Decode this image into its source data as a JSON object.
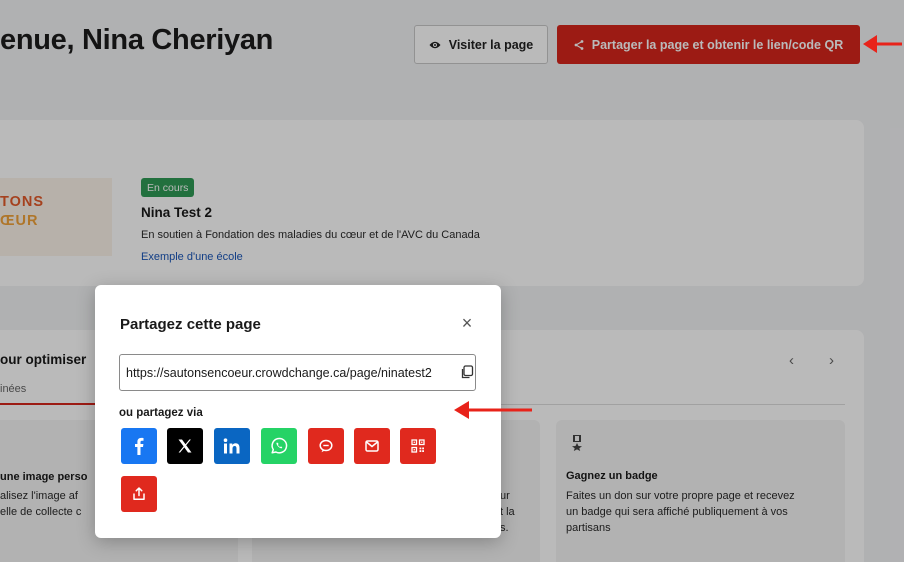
{
  "header": {
    "title": "enue, Nina Cheriyan",
    "visit_label": "Visiter la page",
    "share_label": "Partager la page et obtenir le lien/code QR"
  },
  "campaign": {
    "logo_line1": "TONS",
    "logo_line2": "ŒUR",
    "status": "En cours",
    "name": "Nina Test 2",
    "support": "En soutien à Fondation des maladies du cœur et de l'AVC du Canada",
    "school": "Exemple d'une école"
  },
  "section": {
    "title": "our optimiser",
    "tab_label": "inées",
    "prev": "‹",
    "next": "›",
    "card_left": {
      "title": "une image perso",
      "line1": "alisez l'image af",
      "line2": "elle de collecte c"
    },
    "card_middle": {
      "line1": "ur",
      "line2": "t la",
      "line3": "s."
    },
    "card_right": {
      "title": "Gagnez un badge",
      "line1": "Faites un don sur votre propre page et recevez",
      "line2": "un badge qui sera affiché publiquement à vos",
      "line3": "partisans"
    }
  },
  "modal": {
    "title": "Partagez cette page",
    "close": "×",
    "link_value": "https://sautonsencoeur.crowdchange.ca/page/ninatest2",
    "share_via": "ou partagez via",
    "buttons": [
      {
        "name": "facebook",
        "icon": "facebook-icon",
        "color": "#1877f2"
      },
      {
        "name": "x",
        "icon": "x-icon",
        "color": "#000000"
      },
      {
        "name": "linkedin",
        "icon": "linkedin-icon",
        "color": "#0a66c2"
      },
      {
        "name": "whatsapp",
        "icon": "whatsapp-icon",
        "color": "#25d366"
      },
      {
        "name": "messenger",
        "icon": "chat-icon",
        "color": "#e0291e"
      },
      {
        "name": "email",
        "icon": "mail-icon",
        "color": "#e0291e"
      },
      {
        "name": "qr-code",
        "icon": "qr-code-icon",
        "color": "#e0291e"
      },
      {
        "name": "share-more",
        "icon": "share-out-icon",
        "color": "#e0291e"
      }
    ]
  },
  "colors": {
    "brand_red": "#d6261c",
    "annotation_red": "#e8231a",
    "status_green": "#2f9a55",
    "link_blue": "#1a56b8"
  }
}
